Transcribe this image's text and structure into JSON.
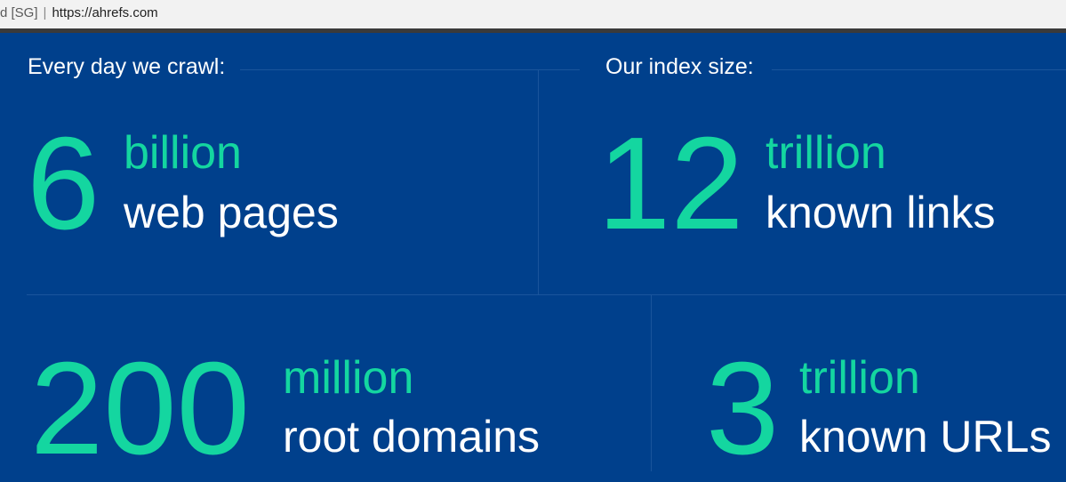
{
  "address_bar": {
    "secure_label": "d [SG]",
    "url": "https://ahrefs.com"
  },
  "crawl": {
    "title": "Every day we crawl:",
    "pages": {
      "number": "6",
      "unit": "billion",
      "label": "web pages"
    },
    "domains": {
      "number": "200",
      "unit": "million",
      "label": "root domains"
    }
  },
  "index": {
    "title": "Our index size:",
    "links": {
      "number": "12",
      "unit": "trillion",
      "label": "known links"
    },
    "urls": {
      "number": "3",
      "unit": "trillion",
      "label": "known URLs"
    }
  },
  "colors": {
    "background": "#00408c",
    "accent": "#14d6a0",
    "text": "#ffffff"
  }
}
